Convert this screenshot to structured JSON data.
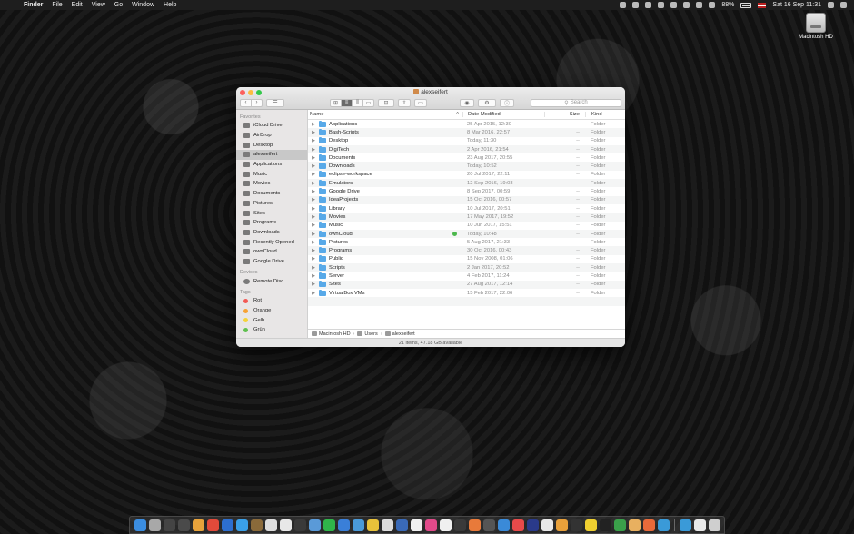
{
  "menubar": {
    "app_name": "Finder",
    "items": [
      "File",
      "Edit",
      "View",
      "Go",
      "Window",
      "Help"
    ],
    "battery": "88%",
    "datetime": "Sat 16 Sep  11:31"
  },
  "desktop": {
    "drive_label": "Macintosh HD"
  },
  "window": {
    "title": "alexseifert",
    "search_placeholder": "Search",
    "sidebar": {
      "favorites_header": "Favorites",
      "favorites": [
        "iCloud Drive",
        "AirDrop",
        "Desktop",
        "alexseifert",
        "Applications",
        "Music",
        "Movies",
        "Documents",
        "Pictures",
        "Sites",
        "Programs",
        "Downloads",
        "Recently Opened",
        "ownCloud",
        "Google Drive"
      ],
      "devices_header": "Devices",
      "devices": [
        "Remote Disc"
      ],
      "tags_header": "Tags",
      "tags": [
        {
          "label": "Rot",
          "color": "#f25a55"
        },
        {
          "label": "Orange",
          "color": "#f7a234"
        },
        {
          "label": "Gelb",
          "color": "#f5d33a"
        },
        {
          "label": "Grün",
          "color": "#5fc04f"
        }
      ]
    },
    "columns": {
      "name": "Name",
      "date": "Date Modified",
      "size": "Size",
      "kind": "Kind"
    },
    "rows": [
      {
        "name": "Applications",
        "date": "25 Apr 2015, 12:30",
        "size": "--",
        "kind": "Folder"
      },
      {
        "name": "Bash-Scripts",
        "date": "8 Mar 2016, 22:57",
        "size": "--",
        "kind": "Folder"
      },
      {
        "name": "Desktop",
        "date": "Today, 11:30",
        "size": "--",
        "kind": "Folder"
      },
      {
        "name": "DigiTech",
        "date": "2 Apr 2016, 21:54",
        "size": "--",
        "kind": "Folder"
      },
      {
        "name": "Documents",
        "date": "23 Aug 2017, 20:55",
        "size": "--",
        "kind": "Folder"
      },
      {
        "name": "Downloads",
        "date": "Today, 10:52",
        "size": "--",
        "kind": "Folder"
      },
      {
        "name": "eclipse-workspace",
        "date": "20 Jul 2017, 22:11",
        "size": "--",
        "kind": "Folder"
      },
      {
        "name": "Emulators",
        "date": "12 Sep 2016, 19:03",
        "size": "--",
        "kind": "Folder"
      },
      {
        "name": "Google Drive",
        "date": "8 Sep 2017, 00:59",
        "size": "--",
        "kind": "Folder"
      },
      {
        "name": "IdeaProjects",
        "date": "15 Oct 2016, 00:57",
        "size": "--",
        "kind": "Folder"
      },
      {
        "name": "Library",
        "date": "10 Jul 2017, 20:51",
        "size": "--",
        "kind": "Folder"
      },
      {
        "name": "Movies",
        "date": "17 May 2017, 19:52",
        "size": "--",
        "kind": "Folder"
      },
      {
        "name": "Music",
        "date": "10 Jun 2017, 15:51",
        "size": "--",
        "kind": "Folder"
      },
      {
        "name": "ownCloud",
        "date": "Today, 10:48",
        "size": "--",
        "kind": "Folder"
      },
      {
        "name": "Pictures",
        "date": "5 Aug 2017, 21:33",
        "size": "--",
        "kind": "Folder"
      },
      {
        "name": "Programs",
        "date": "30 Oct 2016, 00:43",
        "size": "--",
        "kind": "Folder"
      },
      {
        "name": "Public",
        "date": "15 Nov 2008, 01:06",
        "size": "--",
        "kind": "Folder"
      },
      {
        "name": "Scripts",
        "date": "2 Jan 2017, 20:52",
        "size": "--",
        "kind": "Folder"
      },
      {
        "name": "Server",
        "date": "4 Feb 2017, 11:24",
        "size": "--",
        "kind": "Folder"
      },
      {
        "name": "Sites",
        "date": "27 Aug 2017, 12:14",
        "size": "--",
        "kind": "Folder"
      },
      {
        "name": "VirtualBox VMs",
        "date": "15 Feb 2017, 22:06",
        "size": "--",
        "kind": "Folder"
      }
    ],
    "synced_row": "ownCloud",
    "path": [
      "Macintosh HD",
      "Users",
      "alexseifert"
    ],
    "status": "21 items, 47.18 GB available"
  },
  "dock": {
    "colors": [
      "#3b8de0",
      "#a8a8a8",
      "#444",
      "#4a4a4a",
      "#e8a33b",
      "#e24a3a",
      "#2d6fd0",
      "#3aa0e8",
      "#8a6a3a",
      "#ddd",
      "#e8e8e8",
      "#3a3a3a",
      "#5a9ad8",
      "#2fb54a",
      "#3a7fd8",
      "#4a9ad8",
      "#e8c23a",
      "#ddd",
      "#3a6ab8",
      "#f0f0f0",
      "#e24a8a",
      "#f0f0f0",
      "#3a3a3a",
      "#e87a3a",
      "#555",
      "#3a8ad8",
      "#e84a4a",
      "#2a3a8a",
      "#e8e8e8",
      "#e8a03a",
      "#333",
      "#f0d030",
      "#222",
      "#3aa04a",
      "#e8b060",
      "#e86a3a",
      "#3a9ad8",
      "#3a9ad8",
      "#e8e8e8",
      "#cfcfcf"
    ]
  }
}
